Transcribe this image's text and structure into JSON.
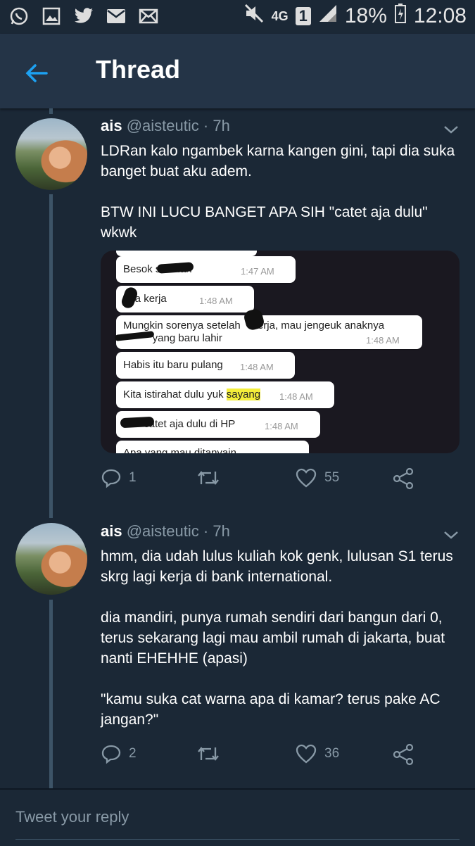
{
  "status_bar": {
    "network": "4G",
    "sim": "1",
    "battery": "18%",
    "time": "12:08",
    "icons": [
      "whatsapp-icon",
      "gallery-icon",
      "twitter-icon",
      "mail-icon",
      "mail-outline-icon",
      "mute-icon",
      "signal-icon",
      "battery-icon"
    ]
  },
  "header": {
    "title": "Thread"
  },
  "tweets": [
    {
      "name": "ais",
      "handle": "@aisteutic",
      "time": "· 7h",
      "text": "LDRan kalo ngambek karna kangen gini, tapi dia suka banget buat aku adem.\n\nBTW INI LUCU BANGET APA SIH \"catet aja dulu\" wkwk",
      "reply_count": "1",
      "like_count": "55",
      "media": {
        "messages": [
          {
            "text": "Besok        sekolah",
            "time": "1:47 AM"
          },
          {
            "text": "     uga kerja",
            "time": "1:48 AM"
          },
          {
            "text": "Mungkin sorenya setelah    kerja, mau jengeuk anaknya",
            "text2": "          yang baru lahir",
            "time": "1:48 AM"
          },
          {
            "text": "Habis itu baru pulang",
            "time": "1:48 AM"
          },
          {
            "text_before": "Kita istirahat dulu yuk ",
            "highlight": "sayang",
            "time": "1:48 AM"
          },
          {
            "text": "       catet aja dulu di HP",
            "time": "1:48 AM"
          },
          {
            "text": "Apa yang mau ditanyain"
          }
        ]
      }
    },
    {
      "name": "ais",
      "handle": "@aisteutic",
      "time": "· 7h",
      "text": "hmm, dia udah lulus kuliah kok genk, lulusan S1 terus skrg lagi kerja di bank international.\n\ndia mandiri, punya rumah sendiri dari bangun dari 0, terus sekarang lagi mau ambil rumah di jakarta, buat nanti EHEHHE (apasi)\n\n\"kamu suka cat warna apa di kamar? terus pake AC jangan?\"",
      "reply_count": "2",
      "like_count": "36"
    }
  ],
  "reply": {
    "placeholder": "Tweet your reply"
  },
  "colors": {
    "background": "#1b2836",
    "appbar": "#243447",
    "accent": "#1da1f2",
    "muted": "#8899a6"
  }
}
